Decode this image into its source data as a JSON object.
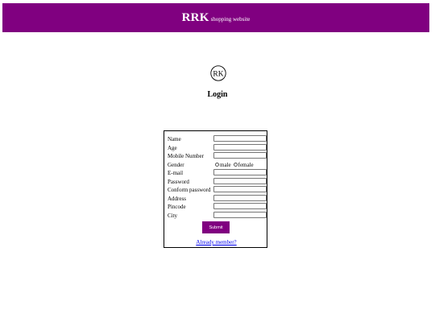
{
  "header": {
    "brand": "RRK",
    "tagline": "shopping website",
    "background": "#800080"
  },
  "logo": {
    "text": "RK",
    "icon": "rrk-monogram-logo"
  },
  "page_title": "Login",
  "form": {
    "fields": [
      {
        "label": "Name",
        "type": "text",
        "value": ""
      },
      {
        "label": "Age",
        "type": "text",
        "value": ""
      },
      {
        "label": "Mobile Number",
        "type": "text",
        "value": ""
      },
      {
        "label": "Gender",
        "type": "radio",
        "options": [
          "male",
          "female"
        ]
      },
      {
        "label": "E-mail",
        "type": "text",
        "value": ""
      },
      {
        "label": "Password",
        "type": "password",
        "value": ""
      },
      {
        "label": "Conform password",
        "type": "password",
        "value": ""
      },
      {
        "label": "Address",
        "type": "text",
        "value": ""
      },
      {
        "label": "Pincode",
        "type": "text",
        "value": ""
      },
      {
        "label": "City",
        "type": "text",
        "value": ""
      }
    ],
    "submit_label": "Submit",
    "member_link": "Already member?"
  }
}
